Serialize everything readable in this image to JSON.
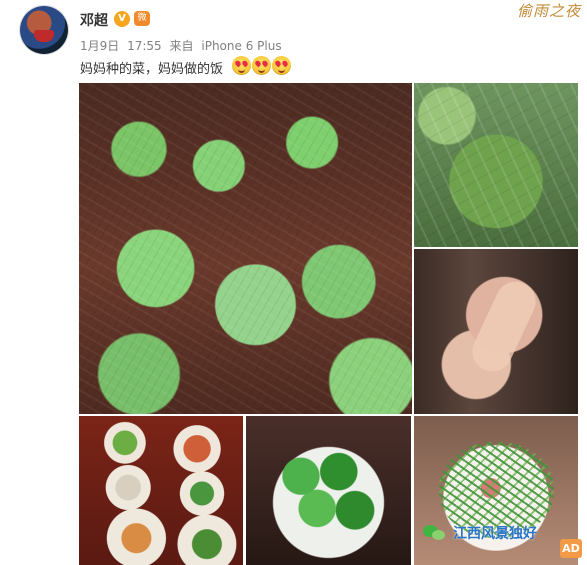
{
  "post": {
    "author": "邓超",
    "date": "1月9日",
    "time": "17:55",
    "source_prefix": "来自",
    "source": "iPhone 6 Plus",
    "text": "妈妈种的菜，妈妈做的饭"
  },
  "badges": {
    "vip": "V",
    "member": "微"
  },
  "decorations": {
    "logo_text": "偷雨之夜",
    "corner_text": "AD",
    "watermark_text": "江西风景独好"
  },
  "icons": {
    "avatar": "avatar-icon",
    "emoji": "heart-eyes-emoji-icon",
    "wechat": "wechat-icon"
  },
  "colors": {
    "vip": "#f6a51c",
    "member": "#f08a2b",
    "meta": "#808080",
    "watermark": "#2a74c8"
  }
}
